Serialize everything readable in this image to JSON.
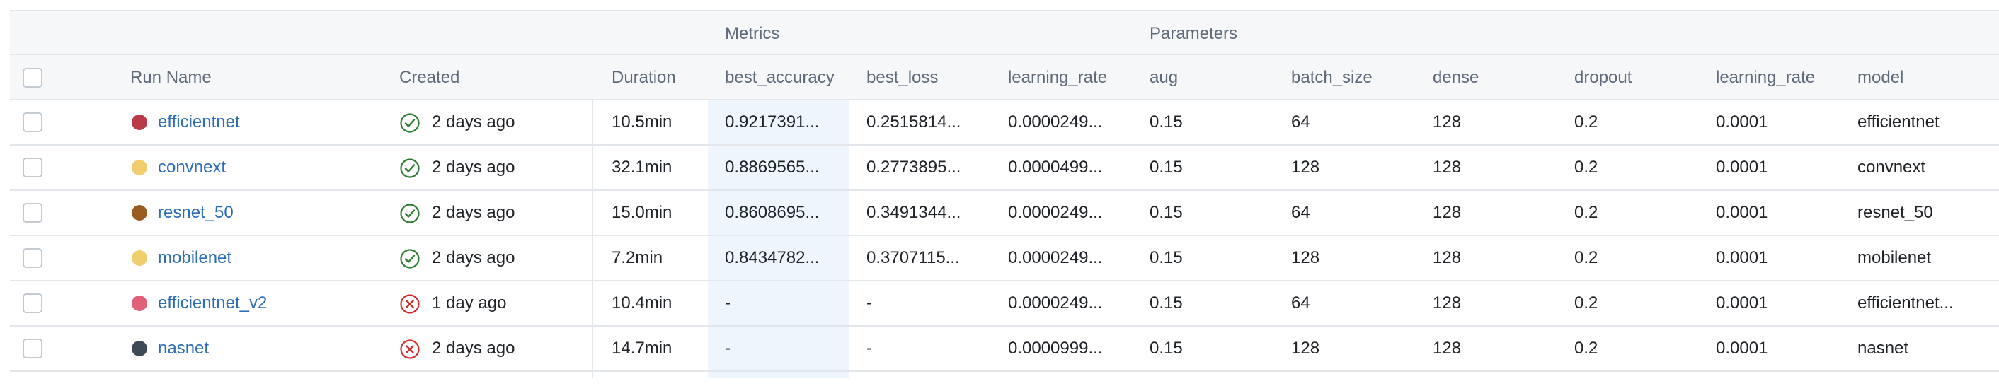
{
  "column_groups": {
    "metrics": "Metrics",
    "parameters": "Parameters"
  },
  "columns": {
    "run_name": "Run Name",
    "created": "Created",
    "duration": "Duration",
    "best_accuracy": "best_accuracy",
    "best_loss": "best_loss",
    "metric_learning_rate": "learning_rate",
    "aug": "aug",
    "batch_size": "batch_size",
    "dense": "dense",
    "dropout": "dropout",
    "param_learning_rate": "learning_rate",
    "model": "model"
  },
  "status_colors": {
    "success": "#2e7d32",
    "failed": "#d32f2f"
  },
  "rows": [
    {
      "name": "efficientnet",
      "color": "#b83a4b",
      "status": "success",
      "status_icon": "check-circle-icon",
      "created": "2 days ago",
      "duration": "10.5min",
      "best_accuracy": "0.9217391...",
      "best_loss": "0.2515814...",
      "metric_learning_rate": "0.0000249...",
      "aug": "0.15",
      "batch_size": "64",
      "dense": "128",
      "dropout": "0.2",
      "param_learning_rate": "0.0001",
      "model": "efficientnet"
    },
    {
      "name": "convnext",
      "color": "#f0cd6e",
      "status": "success",
      "status_icon": "check-circle-icon",
      "created": "2 days ago",
      "duration": "32.1min",
      "best_accuracy": "0.8869565...",
      "best_loss": "0.2773895...",
      "metric_learning_rate": "0.0000499...",
      "aug": "0.15",
      "batch_size": "128",
      "dense": "128",
      "dropout": "0.2",
      "param_learning_rate": "0.0001",
      "model": "convnext"
    },
    {
      "name": "resnet_50",
      "color": "#9a5d21",
      "status": "success",
      "status_icon": "check-circle-icon",
      "created": "2 days ago",
      "duration": "15.0min",
      "best_accuracy": "0.8608695...",
      "best_loss": "0.3491344...",
      "metric_learning_rate": "0.0000249...",
      "aug": "0.15",
      "batch_size": "64",
      "dense": "128",
      "dropout": "0.2",
      "param_learning_rate": "0.0001",
      "model": "resnet_50"
    },
    {
      "name": "mobilenet",
      "color": "#f0cd6e",
      "status": "success",
      "status_icon": "check-circle-icon",
      "created": "2 days ago",
      "duration": "7.2min",
      "best_accuracy": "0.8434782...",
      "best_loss": "0.3707115...",
      "metric_learning_rate": "0.0000249...",
      "aug": "0.15",
      "batch_size": "128",
      "dense": "128",
      "dropout": "0.2",
      "param_learning_rate": "0.0001",
      "model": "mobilenet"
    },
    {
      "name": "efficientnet_v2",
      "color": "#e0607a",
      "status": "failed",
      "status_icon": "x-circle-icon",
      "created": "1 day ago",
      "duration": "10.4min",
      "best_accuracy": "-",
      "best_loss": "-",
      "metric_learning_rate": "0.0000249...",
      "aug": "0.15",
      "batch_size": "64",
      "dense": "128",
      "dropout": "0.2",
      "param_learning_rate": "0.0001",
      "model": "efficientnet..."
    },
    {
      "name": "nasnet",
      "color": "#3e4a56",
      "status": "failed",
      "status_icon": "x-circle-icon",
      "created": "2 days ago",
      "duration": "14.7min",
      "best_accuracy": "-",
      "best_loss": "-",
      "metric_learning_rate": "0.0000999...",
      "aug": "0.15",
      "batch_size": "128",
      "dense": "128",
      "dropout": "0.2",
      "param_learning_rate": "0.0001",
      "model": "nasnet"
    }
  ]
}
